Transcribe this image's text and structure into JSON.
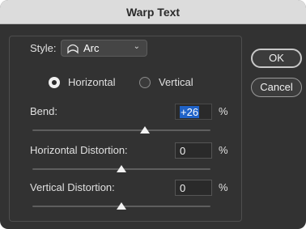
{
  "window": {
    "title": "Warp Text"
  },
  "style": {
    "label": "Style:",
    "value": "Arc",
    "icon": "arc-icon"
  },
  "orientation": {
    "options": [
      {
        "label": "Horizontal",
        "selected": true
      },
      {
        "label": "Vertical",
        "selected": false
      }
    ]
  },
  "bend": {
    "label": "Bend:",
    "value": "+26",
    "unit": "%",
    "slider_percent": 26
  },
  "horizontal_distortion": {
    "label": "Horizontal Distortion:",
    "value": "0",
    "unit": "%",
    "slider_percent": 0
  },
  "vertical_distortion": {
    "label": "Vertical Distortion:",
    "value": "0",
    "unit": "%",
    "slider_percent": 0
  },
  "buttons": {
    "ok": "OK",
    "cancel": "Cancel"
  },
  "colors": {
    "panel": "#323232",
    "titlebar": "#dcdcdc",
    "selection": "#1f62c7"
  }
}
